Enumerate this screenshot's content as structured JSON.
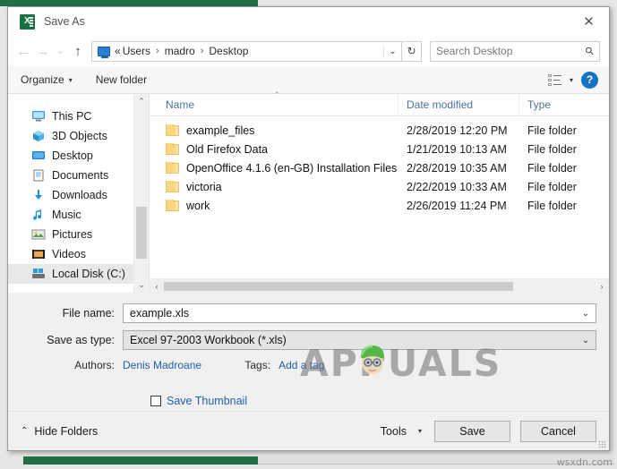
{
  "window": {
    "title": "Save As",
    "app_icon": "excel-icon",
    "close_label": "✕"
  },
  "address": {
    "back_icon": "←",
    "forward_icon": "→",
    "recent_icon": "⌄",
    "up_icon": "↑",
    "location_icon": "desktop-icon",
    "prefix": "«",
    "crumbs": [
      "Users",
      "madro",
      "Desktop"
    ],
    "separator": "›",
    "dropdown_icon": "⌄",
    "refresh_icon": "↻"
  },
  "search": {
    "placeholder": "Search Desktop",
    "icon": "search-icon"
  },
  "toolbar": {
    "organize_label": "Organize",
    "organize_caret": "▾",
    "new_folder_label": "New folder",
    "view_caret": "▾",
    "help_label": "?"
  },
  "sidebar": {
    "items": [
      {
        "label": "This PC",
        "icon": "this-pc-icon",
        "selected": false
      },
      {
        "label": "3D Objects",
        "icon": "3d-objects-icon",
        "selected": false
      },
      {
        "label": "Desktop",
        "icon": "desktop-icon",
        "selected": false
      },
      {
        "label": "Documents",
        "icon": "documents-icon",
        "selected": false
      },
      {
        "label": "Downloads",
        "icon": "downloads-icon",
        "selected": false
      },
      {
        "label": "Music",
        "icon": "music-icon",
        "selected": false
      },
      {
        "label": "Pictures",
        "icon": "pictures-icon",
        "selected": false
      },
      {
        "label": "Videos",
        "icon": "videos-icon",
        "selected": false
      },
      {
        "label": "Local Disk (C:)",
        "icon": "drive-icon",
        "selected": true
      }
    ],
    "scroll_up_icon": "⌃",
    "scroll_down_icon": "⌄"
  },
  "filelist": {
    "columns": {
      "name": "Name",
      "date": "Date modified",
      "type": "Type"
    },
    "sort_indicator": "⌃",
    "rows": [
      {
        "name": "example_files",
        "date": "2/28/2019 12:20 PM",
        "type": "File folder"
      },
      {
        "name": "Old Firefox Data",
        "date": "1/21/2019 10:13 AM",
        "type": "File folder"
      },
      {
        "name": "OpenOffice 4.1.6 (en-GB) Installation Files",
        "date": "2/28/2019 10:35 AM",
        "type": "File folder"
      },
      {
        "name": "victoria",
        "date": "2/22/2019 10:33 AM",
        "type": "File folder"
      },
      {
        "name": "work",
        "date": "2/26/2019 11:24 PM",
        "type": "File folder"
      }
    ],
    "hscroll_left_icon": "‹",
    "hscroll_right_icon": "›"
  },
  "form": {
    "filename_label": "File name:",
    "filename_value": "example.xls",
    "filetype_label": "Save as type:",
    "filetype_value": "Excel 97-2003 Workbook (*.xls)",
    "dropdown_icon": "⌄",
    "authors_label": "Authors:",
    "authors_value": "Denis Madroane",
    "tags_label": "Tags:",
    "tags_value": "Add a tag",
    "thumbnail_label": "Save Thumbnail",
    "thumbnail_checked": false
  },
  "footer": {
    "hide_folders_label": "Hide Folders",
    "hide_folders_icon": "⌃",
    "tools_label": "Tools",
    "tools_caret": "▾",
    "save_label": "Save",
    "cancel_label": "Cancel"
  },
  "watermarks": {
    "appuals": "APPUALS",
    "site": "wsxdn.com"
  },
  "colors": {
    "accent_green": "#1f6f47",
    "link_blue": "#1f5fa8",
    "help_blue": "#1473c4",
    "folder_yellow": "#fcd77f"
  }
}
